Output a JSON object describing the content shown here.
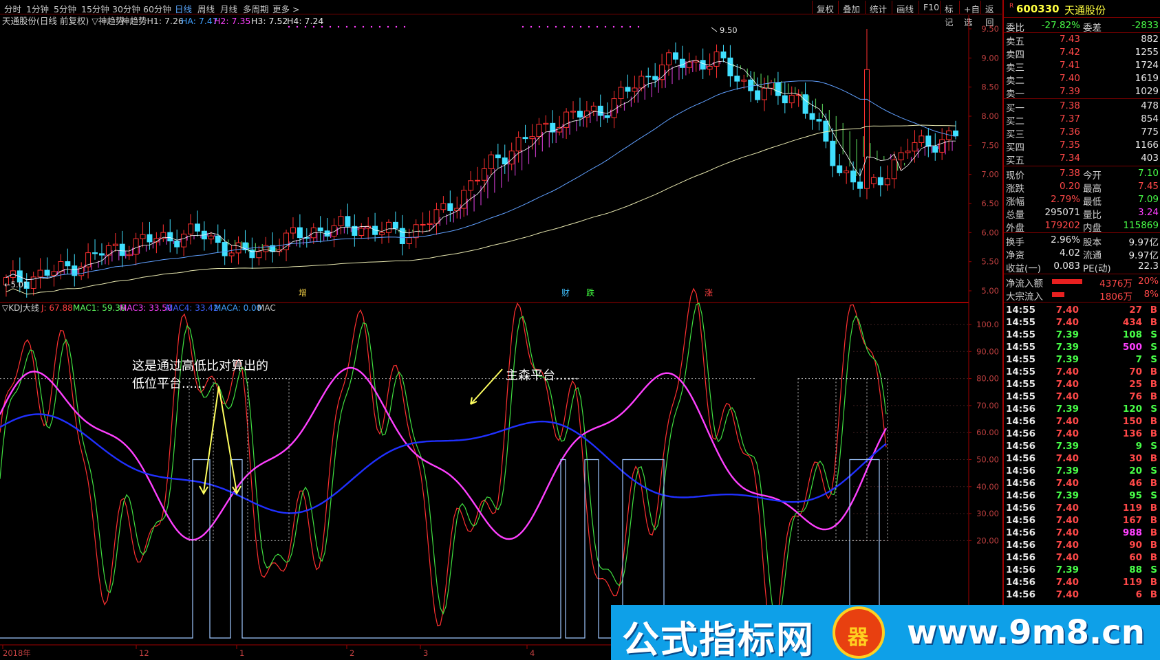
{
  "toolbar": {
    "periods": [
      "分时",
      "1分钟",
      "5分钟",
      "15分钟",
      "30分钟",
      "60分钟",
      "日线",
      "周线",
      "月线",
      "多周期",
      "更多 >"
    ],
    "active_period": "日线",
    "right_buttons": [
      "复权",
      "叠加",
      "统计",
      "画线",
      "F10",
      "标记",
      "+自选",
      "返回"
    ]
  },
  "main_chart": {
    "title": "天通股份(日线 前复权) ▽神趋势",
    "indicator": "神趋势H1: 7.26",
    "ha": "HA: 7.47",
    "h2": "H2: 7.35",
    "h3": "H3: 7.52",
    "h4": "H4: 7.24",
    "high_label": "9.50",
    "low_label": "5.01",
    "signals": [
      "增",
      "财",
      "跌",
      "涨"
    ],
    "y_ticks": [
      "9.50",
      "9.00",
      "8.50",
      "8.00",
      "7.50",
      "7.00",
      "6.50",
      "6.00",
      "5.50",
      "5.00"
    ]
  },
  "sub_chart": {
    "title": "▽KDJ大线",
    "j": "J: 67.88",
    "mac1": "MAC1: 59.36",
    "mac3": "MAC3: 33.50",
    "mac4": "MAC4: 33.42",
    "maca": "MACA: 0.00",
    "mac_cut": "MAC",
    "annotation_1": "这是通过高低比对算出的",
    "annotation_2": "低位平台......",
    "annotation_3": "主森平台......",
    "y_ticks": [
      "100.0",
      "90.00",
      "80.00",
      "70.00",
      "60.00",
      "50.00",
      "40.00",
      "30.00",
      "20.00"
    ]
  },
  "x_axis": [
    "2018年",
    "12",
    "1",
    "2",
    "3",
    "4"
  ],
  "quote": {
    "code": "600330",
    "name": "天通股份",
    "r_mark": "R",
    "wei_bi_label": "委比",
    "wei_bi": "-27.82%",
    "wei_cha_label": "委差",
    "wei_cha": "-2833",
    "asks": [
      {
        "label": "卖五",
        "price": "7.43",
        "vol": "882"
      },
      {
        "label": "卖四",
        "price": "7.42",
        "vol": "1255"
      },
      {
        "label": "卖三",
        "price": "7.41",
        "vol": "1724"
      },
      {
        "label": "卖二",
        "price": "7.40",
        "vol": "1619"
      },
      {
        "label": "卖一",
        "price": "7.39",
        "vol": "1029"
      }
    ],
    "bids": [
      {
        "label": "买一",
        "price": "7.38",
        "vol": "478"
      },
      {
        "label": "买二",
        "price": "7.37",
        "vol": "854"
      },
      {
        "label": "买三",
        "price": "7.36",
        "vol": "775"
      },
      {
        "label": "买四",
        "price": "7.35",
        "vol": "1166"
      },
      {
        "label": "买五",
        "price": "7.34",
        "vol": "403"
      }
    ],
    "stats": [
      {
        "l1": "现价",
        "v1": "7.38",
        "l2": "今开",
        "v2": "7.10"
      },
      {
        "l1": "涨跌",
        "v1": "0.20",
        "l2": "最高",
        "v2": "7.45"
      },
      {
        "l1": "涨幅",
        "v1": "2.79%",
        "l2": "最低",
        "v2": "7.09"
      },
      {
        "l1": "总量",
        "v1": "295071",
        "l2": "量比",
        "v2": "3.24"
      },
      {
        "l1": "外盘",
        "v1": "179202",
        "l2": "内盘",
        "v2": "115869"
      }
    ],
    "stats2": [
      {
        "l1": "换手",
        "v1": "2.96%",
        "l2": "股本",
        "v2": "9.97亿"
      },
      {
        "l1": "净资",
        "v1": "4.02",
        "l2": "流通",
        "v2": "9.97亿"
      },
      {
        "l1": "收益(一)",
        "v1": "0.083",
        "l2": "PE(动)",
        "v2": "22.3"
      }
    ],
    "flows": [
      {
        "label": "净流入额",
        "value": "4376万",
        "pct": "20%",
        "fill": 0.2
      },
      {
        "label": "大宗流入",
        "value": "1806万",
        "pct": "8%",
        "fill": 0.08
      }
    ],
    "ticks": [
      {
        "t": "14:55",
        "p": "7.40",
        "v": "27",
        "s": "B"
      },
      {
        "t": "14:55",
        "p": "7.40",
        "v": "434",
        "s": "B"
      },
      {
        "t": "14:55",
        "p": "7.39",
        "v": "108",
        "s": "S"
      },
      {
        "t": "14:55",
        "p": "7.39",
        "v": "500",
        "s": "S"
      },
      {
        "t": "14:55",
        "p": "7.39",
        "v": "7",
        "s": "S"
      },
      {
        "t": "14:55",
        "p": "7.40",
        "v": "70",
        "s": "B"
      },
      {
        "t": "14:55",
        "p": "7.40",
        "v": "25",
        "s": "B"
      },
      {
        "t": "14:55",
        "p": "7.40",
        "v": "76",
        "s": "B"
      },
      {
        "t": "14:56",
        "p": "7.39",
        "v": "120",
        "s": "S"
      },
      {
        "t": "14:56",
        "p": "7.40",
        "v": "150",
        "s": "B"
      },
      {
        "t": "14:56",
        "p": "7.40",
        "v": "136",
        "s": "B"
      },
      {
        "t": "14:56",
        "p": "7.39",
        "v": "9",
        "s": "S"
      },
      {
        "t": "14:56",
        "p": "7.40",
        "v": "30",
        "s": "B"
      },
      {
        "t": "14:56",
        "p": "7.39",
        "v": "20",
        "s": "S"
      },
      {
        "t": "14:56",
        "p": "7.40",
        "v": "46",
        "s": "B"
      },
      {
        "t": "14:56",
        "p": "7.39",
        "v": "95",
        "s": "S"
      },
      {
        "t": "14:56",
        "p": "7.40",
        "v": "119",
        "s": "B"
      },
      {
        "t": "14:56",
        "p": "7.40",
        "v": "167",
        "s": "B"
      },
      {
        "t": "14:56",
        "p": "7.40",
        "v": "988",
        "s": "B"
      },
      {
        "t": "14:56",
        "p": "7.40",
        "v": "90",
        "s": "B"
      },
      {
        "t": "14:56",
        "p": "7.40",
        "v": "60",
        "s": "B"
      },
      {
        "t": "14:56",
        "p": "7.39",
        "v": "88",
        "s": "S"
      },
      {
        "t": "14:56",
        "p": "7.40",
        "v": "119",
        "s": "B"
      },
      {
        "t": "14:56",
        "p": "7.40",
        "v": "6",
        "s": "B"
      }
    ]
  },
  "watermark": {
    "text": "公式指标网",
    "url": "www.9m8.cn",
    "logo": "器"
  }
}
